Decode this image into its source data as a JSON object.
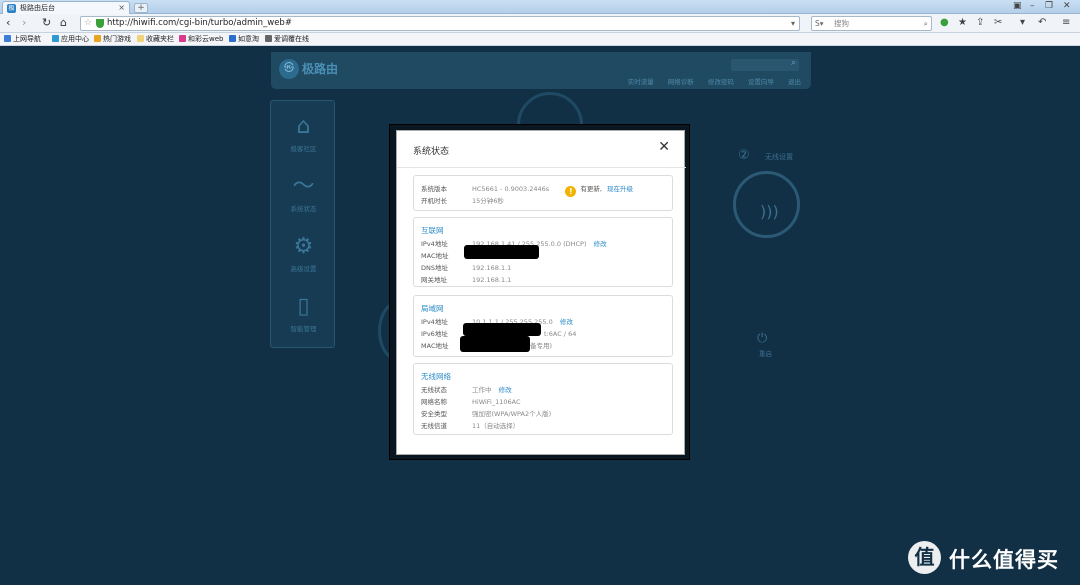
{
  "browser": {
    "tab_title": "极路由后台",
    "new_tab": "+",
    "url": "http://hiwifi.com/cgi-bin/turbo/admin_web#",
    "search_placeholder": "搜狗",
    "bookmarks": [
      "上网导航",
      "应用中心",
      "热门游戏",
      "收藏夹栏",
      "和彩云web",
      "如意淘",
      "爱调覆在线"
    ]
  },
  "app": {
    "brand": "极路由",
    "header_links": [
      "实时流量",
      "网络诊断",
      "修改密码",
      "设置向导",
      "退出"
    ],
    "sidebar": [
      "极客社区",
      "系统状态",
      "高级设置",
      "智能管理"
    ],
    "bg_step2": "无线设置",
    "bg_reboot": "重启"
  },
  "modal": {
    "title": "系统状态",
    "system": {
      "version_label": "系统版本",
      "version_value": "HC5661 - 0.9003.2446s",
      "update_text": "有更新,",
      "update_link": "现在升级",
      "uptime_label": "开机时长",
      "uptime_value": "15分钟6秒"
    },
    "internet": {
      "title": "互联网",
      "ipv4_label": "IPv4地址",
      "ipv4_value": "192.168.1.41 / 255.255.0.0 (DHCP)",
      "ipv4_link": "修改",
      "mac_label": "MAC地址",
      "dns_label": "DNS地址",
      "dns_value": "192.168.1.1",
      "gw_label": "网关地址",
      "gw_value": "192.168.1.1"
    },
    "lan": {
      "title": "局域网",
      "ipv4_label": "IPv4地址",
      "ipv4_value": "10.1.1.1 / 255.255.255.0",
      "ipv4_link": "修改",
      "ipv6_label": "IPv6地址",
      "ipv6_tail": "t:6AC / 64",
      "mac_label": "MAC地址",
      "mac_tail": "备专用)"
    },
    "wireless": {
      "title": "无线网络",
      "state_label": "无线状态",
      "state_value": "工作中",
      "state_link": "修改",
      "ssid_label": "网络名称",
      "ssid_value": "HiWiFi_1106AC",
      "sec_label": "安全类型",
      "sec_value": "强加密(WPA/WPA2个人版)",
      "ch_label": "无线信道",
      "ch_value": "11（自动选择）"
    }
  },
  "watermark": {
    "logo_glyph": "值",
    "text": "什么值得买"
  }
}
